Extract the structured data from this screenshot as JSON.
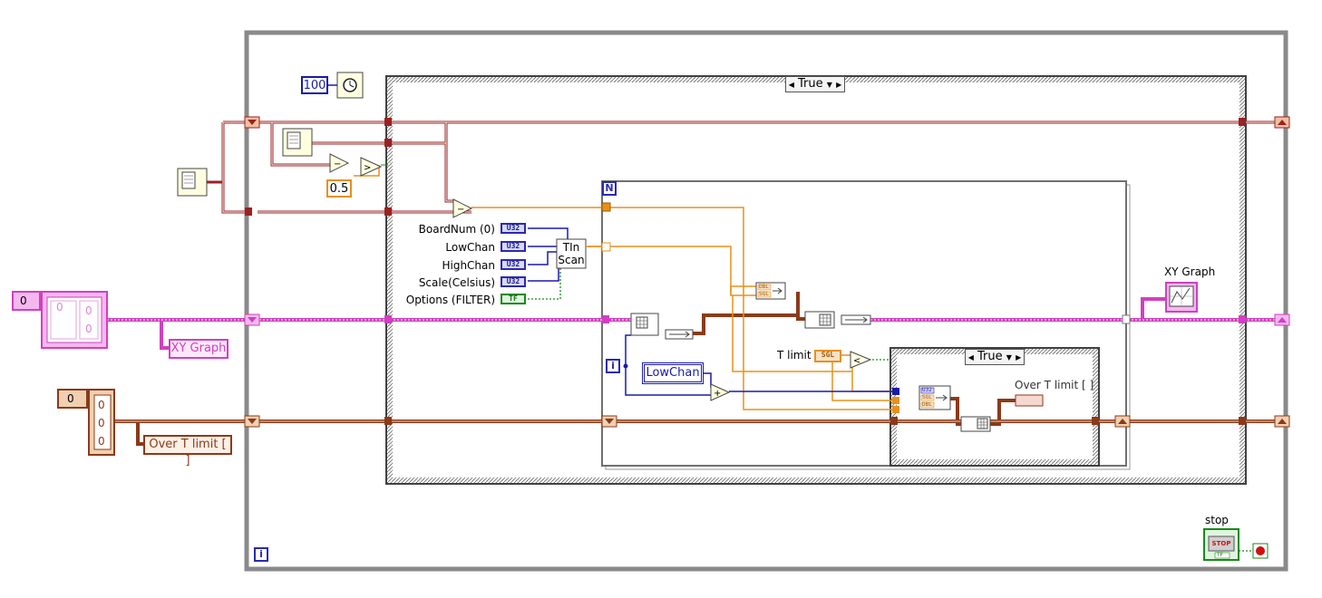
{
  "case_selectors": {
    "outer": "True",
    "inner": "True",
    "arrow": "◀",
    "dropdown": "▼",
    "next": "▶"
  },
  "constants": {
    "wait_ms": "100",
    "threshold": "0.5",
    "array_index_pink": "0",
    "array_index_brown": "0",
    "cluster_index_pink": "0",
    "brown_elements": [
      "0",
      "0",
      "0"
    ],
    "pink_elements": [
      "0",
      "0"
    ]
  },
  "labels": {
    "xy_graph_indicator": "XY Graph",
    "xy_graph_local": "XY Graph",
    "over_t_limit_local": "Over T limit [ ]",
    "over_t_limit_inner": "Over T limit [ ]",
    "t_limit": "T limit",
    "low_chan_control": "LowChan",
    "stop": "stop",
    "for_loop_count": "N",
    "for_loop_iter": "i",
    "while_loop_iter": "i"
  },
  "tin_scan": {
    "title_line1": "TIn",
    "title_line2": "Scan",
    "inputs": [
      {
        "label": "BoardNum (0)",
        "type": "U32"
      },
      {
        "label": "LowChan",
        "type": "U32"
      },
      {
        "label": "HighChan",
        "type": "U32"
      },
      {
        "label": "Scale(Celsius)",
        "type": "U32"
      },
      {
        "label": "Options (FILTER)",
        "type": "TF"
      }
    ]
  },
  "type_tags": {
    "sgl": "SGL",
    "dbl": "DBL",
    "u32": "U32",
    "tf": "TF",
    "stop_btn": "STOP"
  },
  "colors": {
    "loop_border": "#8a8a8a",
    "case_border": "#404040",
    "pink_wire": "#d040c0",
    "brown_wire": "#8b3a1a",
    "orange_wire": "#e8901c",
    "blue_wire": "#1a1aa8",
    "green_wire": "#1a8a1a",
    "dark_red_wire": "#9a2222"
  }
}
